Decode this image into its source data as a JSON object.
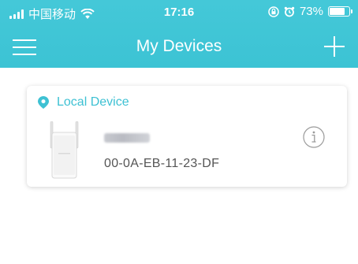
{
  "statusbar": {
    "carrier": "中国移动",
    "time": "17:16",
    "battery_percent": "73%",
    "battery_level": 0.73
  },
  "navbar": {
    "title": "My Devices",
    "menu_icon": "hamburger-menu-icon",
    "add_icon": "plus-icon"
  },
  "device_card": {
    "section_label": "Local Device",
    "section_icon": "location-pin-icon",
    "device_name": "",
    "mac_address": "00-0A-EB-11-23-DF",
    "info_icon": "info-icon"
  },
  "colors": {
    "header": "#3cc3d4",
    "accent": "#3ec1d3",
    "text_secondary": "#555555",
    "background": "#ffffff"
  }
}
